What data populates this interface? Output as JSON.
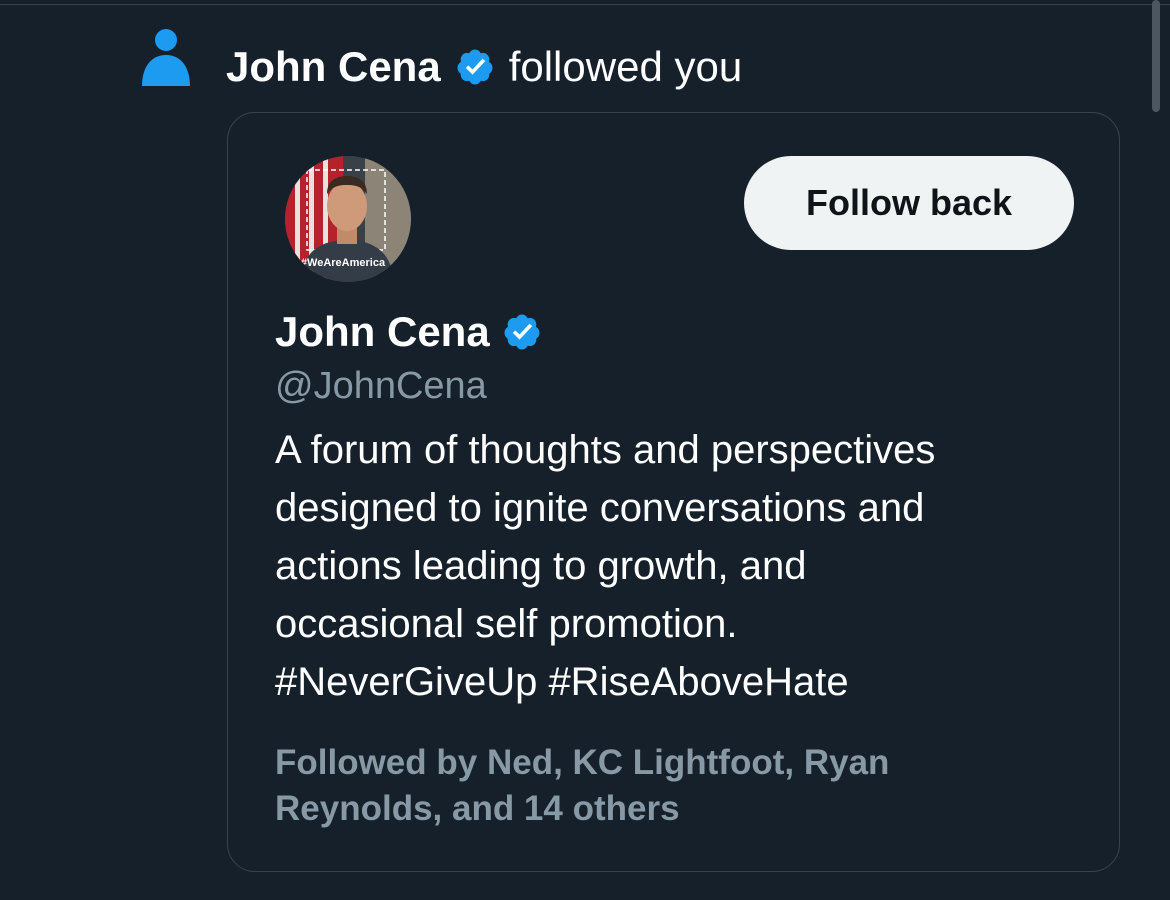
{
  "colors": {
    "background": "#15202b",
    "accent": "#1d9bf0",
    "card_border": "#38444d",
    "secondary_text": "#8899a6",
    "button_bg": "#eff3f4",
    "button_text": "#0f1419"
  },
  "notification": {
    "icon": "person-icon",
    "user_name": "John Cena",
    "verified_icon": "verified-badge-icon",
    "action_text": "followed you"
  },
  "profile_card": {
    "avatar_caption": "#WeAreAmerica",
    "follow_button_label": "Follow back",
    "name": "John Cena",
    "verified_icon": "verified-badge-icon",
    "handle": "@JohnCena",
    "bio_lines": [
      "A forum of thoughts and perspectives",
      "designed to ignite conversations and",
      "actions leading to growth, and",
      "occasional self promotion.",
      "#NeverGiveUp #RiseAboveHate"
    ],
    "followed_by_lines": [
      "Followed by Ned, KC Lightfoot, Ryan",
      "Reynolds, and 14 others"
    ]
  }
}
